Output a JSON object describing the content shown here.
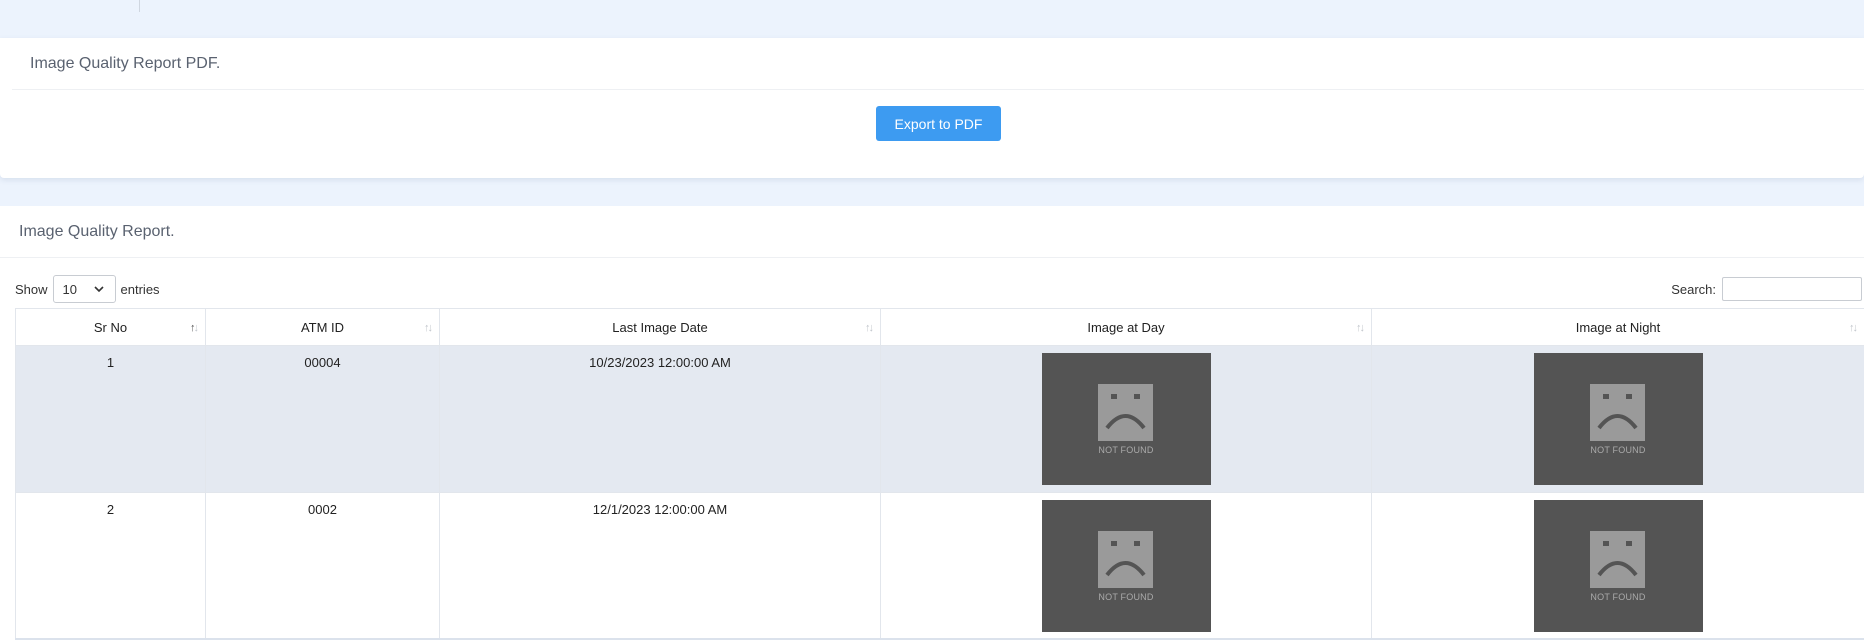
{
  "pdf_card": {
    "title": "Image Quality Report PDF.",
    "export_label": "Export to PDF"
  },
  "report_card": {
    "title": "Image Quality Report.",
    "length": {
      "show_label": "Show",
      "value": "10",
      "entries_label": "entries"
    },
    "search": {
      "label": "Search:",
      "value": ""
    },
    "columns": [
      "Sr No",
      "ATM ID",
      "Last Image Date",
      "Image at Day",
      "Image at Night"
    ],
    "rows": [
      {
        "sr_no": "1",
        "atm_id": "00004",
        "last_image_date": "10/23/2023 12:00:00 AM",
        "day_image": "NOT FOUND",
        "night_image": "NOT FOUND"
      },
      {
        "sr_no": "2",
        "atm_id": "0002",
        "last_image_date": "12/1/2023 12:00:00 AM",
        "day_image": "NOT FOUND",
        "night_image": "NOT FOUND"
      }
    ]
  },
  "colors": {
    "accent": "#3d9bf1",
    "page_bg": "#ecf3fd",
    "row_highlight": "#e4e9f1",
    "placeholder_bg": "#545454"
  }
}
